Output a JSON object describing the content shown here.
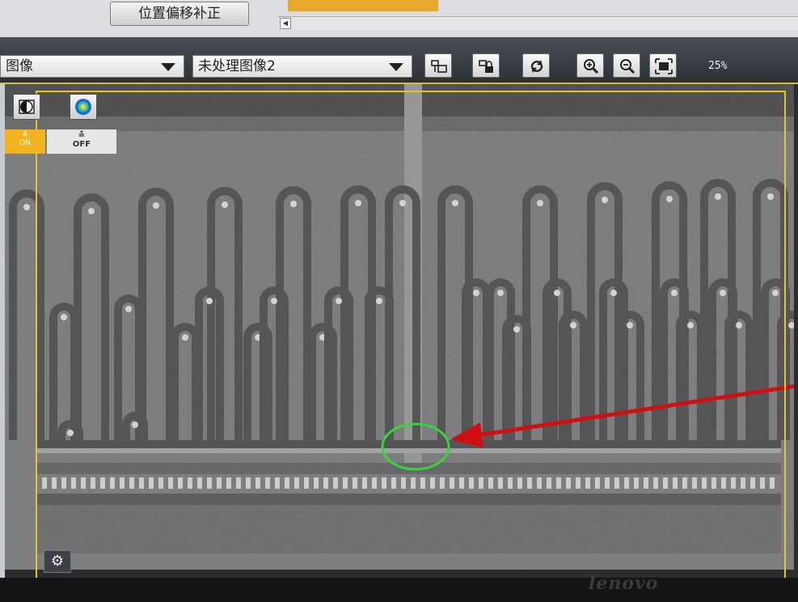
{
  "top_panel": {
    "offset_button_label": "位置偏移补正"
  },
  "toolbar": {
    "image_select_left": "图像",
    "image_select_right": "未处理图像2",
    "zoom_level": "25%"
  },
  "viewer": {
    "toggle_on_label": "ON",
    "toggle_off_label": "OFF"
  },
  "bezel": {
    "brand": "lenovo"
  },
  "colors": {
    "frame_yellow": "#e6c42a",
    "toggle_orange": "#f1b41e",
    "annotation_red": "#d01010",
    "circle_green": "#36d636"
  }
}
